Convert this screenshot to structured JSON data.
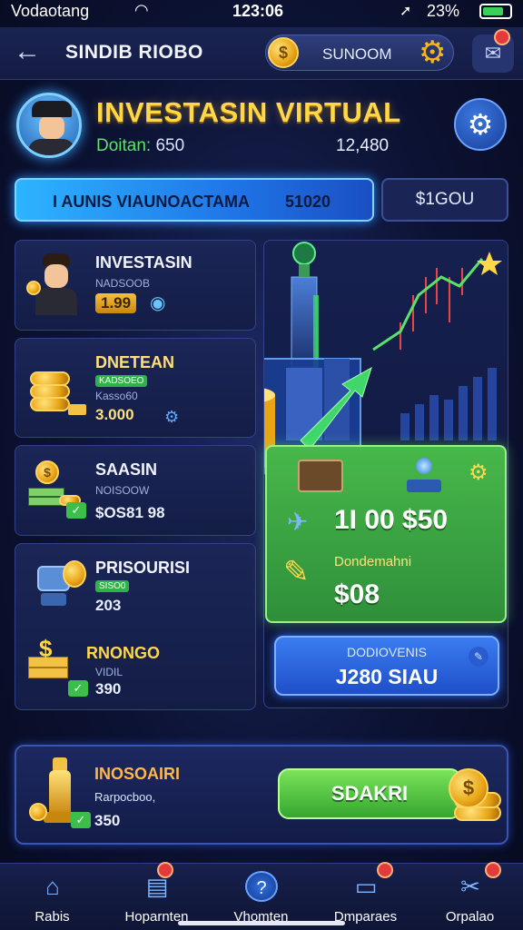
{
  "status_bar": {
    "carrier": "Vodaotang",
    "time": "123:06",
    "battery_pct": "23%",
    "battery_level": 0.8
  },
  "header": {
    "title": "SINDIB RIOBO",
    "currency_label": "SUNOOM"
  },
  "profile": {
    "title": "INVESTASIN VIRTUAL",
    "sub_label": "Doitan:",
    "sub_value": "650",
    "right_value": "12,480"
  },
  "balance": {
    "label": "I AUNIS VIAUNOACTAMA",
    "value": "51020",
    "side_value": "$1GOU"
  },
  "cards": [
    {
      "title": "INVESTASIN",
      "sub": "NADSOOB",
      "value": "1.99"
    },
    {
      "title": "DNETEAN",
      "sub": "KADSOEO",
      "sub2": "Kasso60",
      "value": "3.000"
    },
    {
      "title": "SAASIN",
      "sub": "NOISOOW",
      "value": "$OS81 98"
    },
    {
      "title": "PRISOURISI",
      "sub": "SISO0",
      "value": "203"
    },
    {
      "title": "RNONGO",
      "sub": "VIDIL",
      "value": "390"
    }
  ],
  "green_card": {
    "amount": "1I 00 $50",
    "label": "Dondemahni",
    "value": "$08"
  },
  "blue_button": {
    "line1": "DODIOVENIS",
    "line2": "J280 SIAU"
  },
  "bottom_panel": {
    "title": "INOSOAIRI",
    "sub": "Rarpocboo,",
    "value": "350",
    "button_label": "SDAKRI"
  },
  "tabs": [
    {
      "label": "Rabis",
      "icon": "home-icon"
    },
    {
      "label": "Hoparnten",
      "icon": "clipboard-icon"
    },
    {
      "label": "Vhomten",
      "icon": "help-icon"
    },
    {
      "label": "Dmparaes",
      "icon": "cards-icon"
    },
    {
      "label": "Orpalao",
      "icon": "tools-icon"
    }
  ],
  "colors": {
    "accent": "#ffd84a",
    "primary": "#1f76e8",
    "success": "#3bbf4a",
    "background": "#0c1233"
  }
}
